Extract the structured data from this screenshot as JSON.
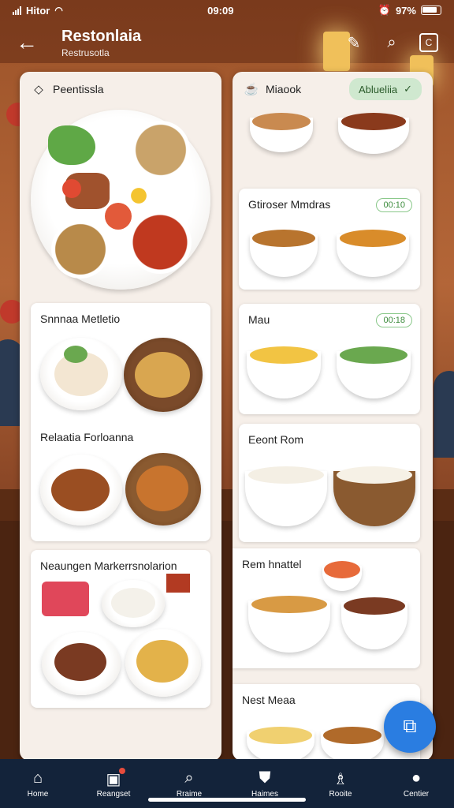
{
  "status_bar": {
    "carrier": "Hitor",
    "time": "09:09",
    "battery": "97%"
  },
  "header": {
    "title": "Restonlaia",
    "subtitle": "Restrusotla"
  },
  "left_panel": {
    "title": "Peentissla",
    "cards": [
      {
        "title": "Snnnaa Metletio"
      },
      {
        "title": "Relaatia Forloanna"
      },
      {
        "title": "Neaungen Markerrsnolarion"
      }
    ]
  },
  "right_panel": {
    "title": "Miaook",
    "filter_label": "Ablueliia",
    "cards": [
      {
        "title": "Gtiroser Mmdras",
        "badge": "00:10"
      },
      {
        "title": "Mau",
        "badge": "00:18"
      },
      {
        "title": "Eeont Rom"
      },
      {
        "title": "Rem hnattel"
      },
      {
        "title": "Nest Meaa"
      }
    ]
  },
  "bottom_nav": [
    {
      "label": "Home",
      "icon": "home-icon"
    },
    {
      "label": "Reangset",
      "icon": "receipt-icon"
    },
    {
      "label": "Rraime",
      "icon": "search-icon"
    },
    {
      "label": "Haimes",
      "icon": "badge-icon"
    },
    {
      "label": "Rooite",
      "icon": "chef-icon"
    },
    {
      "label": "Centier",
      "icon": "profile-icon"
    }
  ]
}
